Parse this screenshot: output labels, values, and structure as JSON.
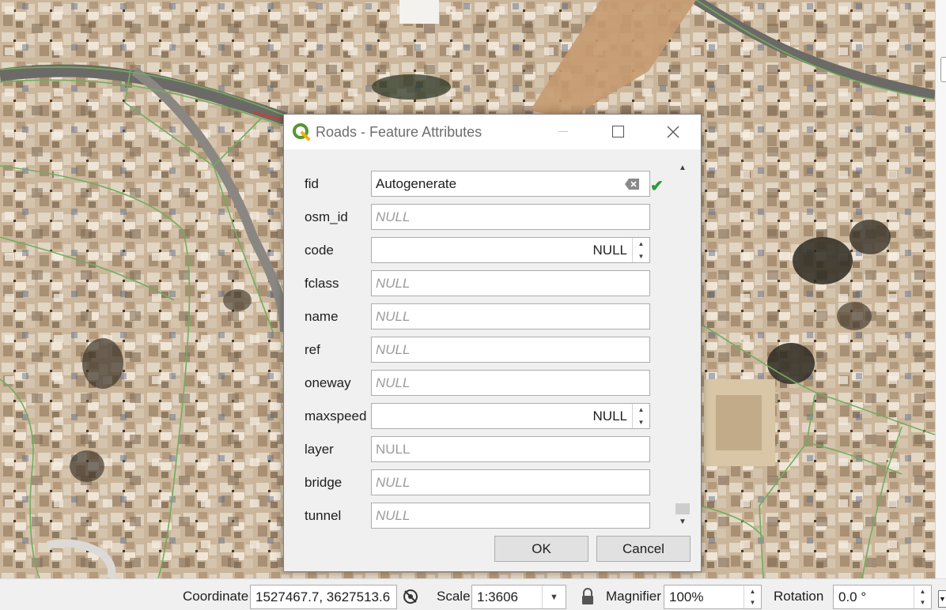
{
  "dialog": {
    "title": "Roads - Feature Attributes",
    "fields": [
      {
        "label": "fid",
        "value": "Autogenerate",
        "style": "text-clear",
        "valid": true
      },
      {
        "label": "osm_id",
        "value": "NULL",
        "style": "null-italic"
      },
      {
        "label": "code",
        "value": "NULL",
        "style": "spinbox"
      },
      {
        "label": "fclass",
        "value": "NULL",
        "style": "null-italic"
      },
      {
        "label": "name",
        "value": "NULL",
        "style": "null-italic"
      },
      {
        "label": "ref",
        "value": "NULL",
        "style": "null-italic"
      },
      {
        "label": "oneway",
        "value": "NULL",
        "style": "null-italic"
      },
      {
        "label": "maxspeed",
        "value": "NULL",
        "style": "spinbox"
      },
      {
        "label": "layer",
        "value": "NULL",
        "style": "null-plain"
      },
      {
        "label": "bridge",
        "value": "NULL",
        "style": "null-italic"
      },
      {
        "label": "tunnel",
        "value": "NULL",
        "style": "null-italic"
      }
    ],
    "ok_label": "OK",
    "cancel_label": "Cancel"
  },
  "statusbar": {
    "coordinate_label": "Coordinate",
    "coordinate_value": "1527467.7, 3627513.6",
    "scale_label": "Scale",
    "scale_value": "1:3606",
    "magnifier_label": "Magnifier",
    "magnifier_value": "100%",
    "rotation_label": "Rotation",
    "rotation_value": "0.0 °"
  },
  "colors": {
    "accent_check": "#2f9a3a",
    "road_lines": "#6fae5e",
    "qgis_logo": "#589632"
  },
  "icons": [
    "qgis-logo-icon",
    "minimize-icon",
    "maximize-icon",
    "close-icon",
    "clear-field-icon",
    "valid-check-icon",
    "spin-up-icon",
    "spin-down-icon",
    "scroll-up-icon",
    "scroll-down-icon",
    "render-toggle-icon",
    "lock-icon",
    "dropdown-arrow-icon"
  ]
}
